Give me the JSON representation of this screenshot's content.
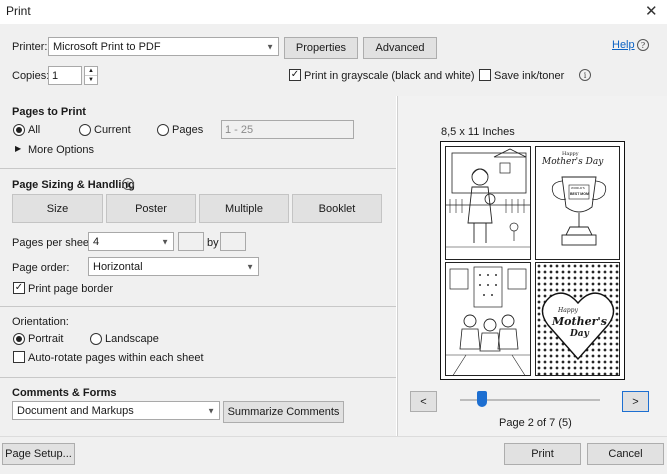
{
  "window": {
    "title": "Print",
    "close_glyph": "✕"
  },
  "header": {
    "printer_label": "Printer:",
    "printer_value": "Microsoft Print to PDF",
    "properties_label": "Properties",
    "advanced_label": "Advanced",
    "help_label": "Help",
    "copies_label": "Copies:",
    "copies_value": "1",
    "grayscale_label": "Print in grayscale (black and white)",
    "grayscale_checked": true,
    "save_ink_label": "Save ink/toner",
    "save_ink_checked": false
  },
  "pages_to_print": {
    "heading": "Pages to Print",
    "all_label": "All",
    "current_label": "Current",
    "pages_label": "Pages",
    "pages_input_value": "1 - 25",
    "selected": "All",
    "more_options_label": "More Options"
  },
  "sizing": {
    "heading": "Page Sizing & Handling",
    "tabs": [
      "Size",
      "Poster",
      "Multiple",
      "Booklet"
    ],
    "pages_per_sheet_label": "Pages per sheet:",
    "pages_per_sheet_value": "4",
    "by_label": "by",
    "page_order_label": "Page order:",
    "page_order_value": "Horizontal",
    "print_border_label": "Print page border",
    "print_border_checked": true
  },
  "orientation": {
    "heading": "Orientation:",
    "portrait_label": "Portrait",
    "landscape_label": "Landscape",
    "selected": "Portrait",
    "auto_rotate_label": "Auto-rotate pages within each sheet",
    "auto_rotate_checked": false
  },
  "comments": {
    "heading": "Comments & Forms",
    "value": "Document and Markups",
    "summarize_label": "Summarize Comments"
  },
  "preview": {
    "paper_size": "8,5 x 11 Inches",
    "page_indicator": "Page 2 of 7 (5)",
    "slider_position": 0.16,
    "prev_glyph": "<",
    "next_glyph": ">",
    "card_texts": {
      "happy": "Happy",
      "mothers_day": "Mother's Day",
      "worlds": "WORLD'S",
      "best_mom": "BEST MOM",
      "happy_heart": "Happy",
      "mothers_heart": "Mother's",
      "day_heart": "Day"
    }
  },
  "footer": {
    "page_setup_label": "Page Setup...",
    "print_label": "Print",
    "cancel_label": "Cancel"
  }
}
